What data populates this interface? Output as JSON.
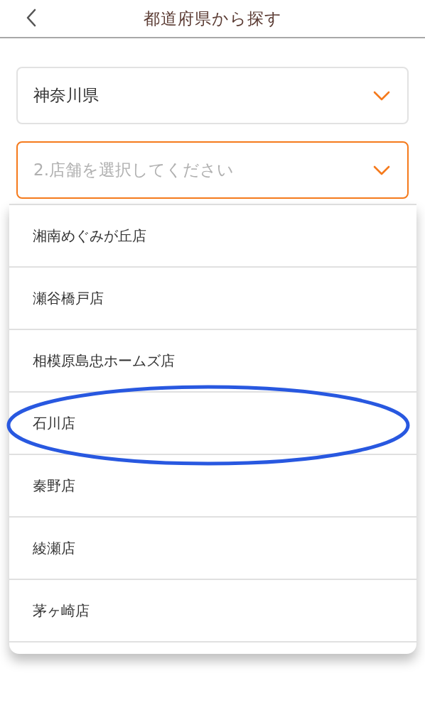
{
  "header": {
    "title": "都道府県から探す"
  },
  "prefecture_select": {
    "value": "神奈川県"
  },
  "store_select": {
    "placeholder": "2.店舗を選択してください",
    "focused": true
  },
  "store_options": [
    {
      "label": "湘南めぐみが丘店",
      "circled": false
    },
    {
      "label": "瀬谷橋戸店",
      "circled": false
    },
    {
      "label": "相模原島忠ホームズ店",
      "circled": false
    },
    {
      "label": "石川店",
      "circled": true
    },
    {
      "label": "秦野店",
      "circled": false
    },
    {
      "label": "綾瀬店",
      "circled": false
    },
    {
      "label": "茅ヶ崎店",
      "circled": false
    }
  ]
}
